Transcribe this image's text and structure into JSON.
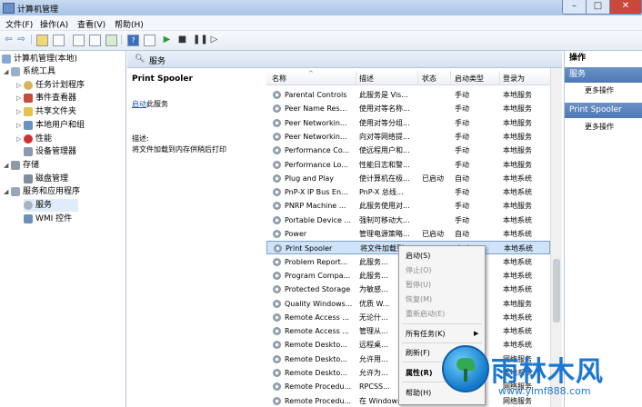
{
  "window": {
    "title": "计算机管理",
    "min": "–",
    "max": "□",
    "close": "✕"
  },
  "menu": [
    "文件(F)",
    "操作(A)",
    "查看(V)",
    "帮助(H)"
  ],
  "tree": {
    "root": "计算机管理(本地)",
    "items": [
      {
        "label": "系统工具"
      },
      {
        "label": "任务计划程序"
      },
      {
        "label": "事件查看器"
      },
      {
        "label": "共享文件夹"
      },
      {
        "label": "本地用户和组"
      },
      {
        "label": "性能"
      },
      {
        "label": "设备管理器"
      },
      {
        "label": "存储"
      },
      {
        "label": "磁盘管理"
      },
      {
        "label": "服务和应用程序"
      },
      {
        "label": "服务"
      },
      {
        "label": "WMI 控件"
      }
    ]
  },
  "center": {
    "header": "服务",
    "selected_service": "Print Spooler",
    "start_link": "启动",
    "start_suffix": "此服务",
    "desc_label": "描述:",
    "desc_text": "将文件加载到内存供稍后打印"
  },
  "table": {
    "columns": [
      "名称",
      "描述",
      "状态",
      "启动类型",
      "登录为"
    ],
    "rows": [
      {
        "name": "Parental Controls",
        "desc": "此服务是 Vis...",
        "status": "",
        "startup": "手动",
        "logon": "本地服务"
      },
      {
        "name": "Peer Name Res...",
        "desc": "使用对等名称...",
        "status": "",
        "startup": "手动",
        "logon": "本地服务"
      },
      {
        "name": "Peer Networkin...",
        "desc": "使用对等分组...",
        "status": "",
        "startup": "手动",
        "logon": "本地服务"
      },
      {
        "name": "Peer Networkin...",
        "desc": "向对等网络提...",
        "status": "",
        "startup": "手动",
        "logon": "本地服务"
      },
      {
        "name": "Performance Co...",
        "desc": "使远程用户和...",
        "status": "",
        "startup": "手动",
        "logon": "本地服务"
      },
      {
        "name": "Performance Lo...",
        "desc": "性能日志和警...",
        "status": "",
        "startup": "手动",
        "logon": "本地服务"
      },
      {
        "name": "Plug and Play",
        "desc": "使计算机在极...",
        "status": "已启动",
        "startup": "自动",
        "logon": "本地系统"
      },
      {
        "name": "PnP-X IP Bus En...",
        "desc": "PnP-X 总线...",
        "status": "",
        "startup": "手动",
        "logon": "本地系统"
      },
      {
        "name": "PNRP Machine ...",
        "desc": "此服务使用对...",
        "status": "",
        "startup": "手动",
        "logon": "本地服务"
      },
      {
        "name": "Portable Device ...",
        "desc": "强制可移动大...",
        "status": "",
        "startup": "手动",
        "logon": "本地系统"
      },
      {
        "name": "Power",
        "desc": "管理电源策略...",
        "status": "已启动",
        "startup": "自动",
        "logon": "本地系统"
      },
      {
        "name": "Print Spooler",
        "desc": "将文件加载到...",
        "status": "",
        "startup": "自动",
        "logon": "本地系统"
      },
      {
        "name": "Problem Report...",
        "desc": "此服务...",
        "status": "",
        "startup": "",
        "logon": "本地系统"
      },
      {
        "name": "Program Compa...",
        "desc": "此服务...",
        "status": "",
        "startup": "",
        "logon": "本地系统"
      },
      {
        "name": "Protected Storage",
        "desc": "为敏感...",
        "status": "",
        "startup": "",
        "logon": "本地系统"
      },
      {
        "name": "Quality Windows...",
        "desc": "优质 W...",
        "status": "",
        "startup": "",
        "logon": "本地服务"
      },
      {
        "name": "Remote Access ...",
        "desc": "无论什...",
        "status": "",
        "startup": "",
        "logon": "本地系统"
      },
      {
        "name": "Remote Access ...",
        "desc": "管理从...",
        "status": "",
        "startup": "",
        "logon": "本地系统"
      },
      {
        "name": "Remote Deskto...",
        "desc": "远程桌...",
        "status": "",
        "startup": "",
        "logon": "本地系统"
      },
      {
        "name": "Remote Deskto...",
        "desc": "允许用...",
        "status": "",
        "startup": "",
        "logon": "网络服务"
      },
      {
        "name": "Remote Deskto...",
        "desc": "允许为...",
        "status": "",
        "startup": "",
        "logon": "本地系统"
      },
      {
        "name": "Remote Procedu...",
        "desc": "RPCSS...",
        "status": "",
        "startup": "",
        "logon": "网络服务"
      },
      {
        "name": "Remote Procedu...",
        "desc": "在 Windows...",
        "status": "",
        "startup": "",
        "logon": "网络服务"
      }
    ]
  },
  "actions": {
    "title": "操作",
    "section1": "服务",
    "more1": "更多操作",
    "section2": "Print Spooler",
    "more2": "更多操作"
  },
  "context_menu": {
    "items": [
      {
        "label": "启动(S)",
        "enabled": true
      },
      {
        "label": "停止(O)",
        "enabled": false
      },
      {
        "label": "暂停(U)",
        "enabled": false
      },
      {
        "label": "恢复(M)",
        "enabled": false
      },
      {
        "label": "重新启动(E)",
        "enabled": false
      },
      {
        "label": "所有任务(K)",
        "enabled": true
      },
      {
        "label": "刷新(F)",
        "enabled": true
      },
      {
        "label": "属性(R)",
        "enabled": true
      },
      {
        "label": "帮助(H)",
        "enabled": true
      }
    ]
  },
  "watermark": {
    "title": "雨林木风",
    "url": "www.ylmf888.com"
  }
}
